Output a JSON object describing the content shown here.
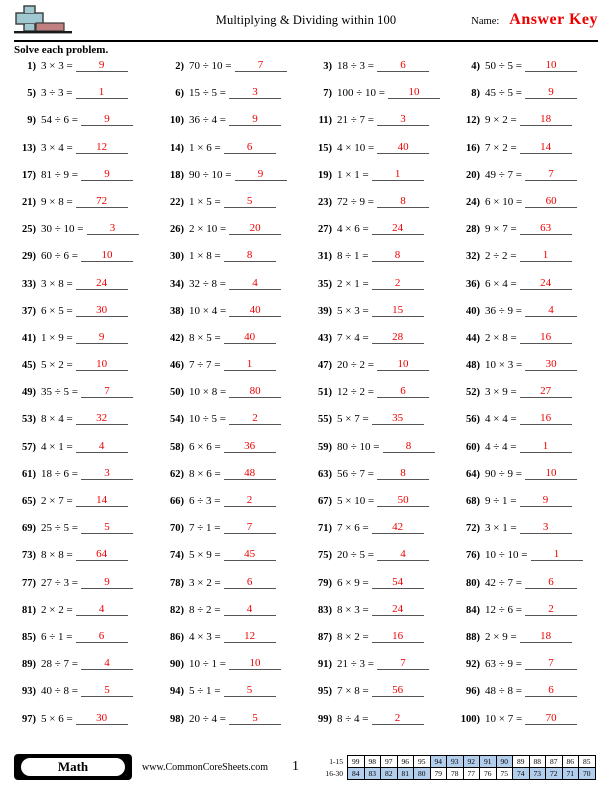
{
  "header": {
    "logo_icon": "plus-minus-icon",
    "title": "Multiplying & Dividing within 100",
    "name_label": "Name:",
    "name_value": "Answer Key"
  },
  "instructions": "Solve each problem.",
  "problems": [
    {
      "n": "1)",
      "expr": "3 × 3 =",
      "ans": "9"
    },
    {
      "n": "2)",
      "expr": "70 ÷ 10 =",
      "ans": "7"
    },
    {
      "n": "3)",
      "expr": "18 ÷ 3 =",
      "ans": "6"
    },
    {
      "n": "4)",
      "expr": "50 ÷ 5 =",
      "ans": "10"
    },
    {
      "n": "5)",
      "expr": "3 ÷ 3 =",
      "ans": "1"
    },
    {
      "n": "6)",
      "expr": "15 ÷ 5 =",
      "ans": "3"
    },
    {
      "n": "7)",
      "expr": "100 ÷ 10 =",
      "ans": "10"
    },
    {
      "n": "8)",
      "expr": "45 ÷ 5 =",
      "ans": "9"
    },
    {
      "n": "9)",
      "expr": "54 ÷ 6 =",
      "ans": "9"
    },
    {
      "n": "10)",
      "expr": "36 ÷ 4 =",
      "ans": "9"
    },
    {
      "n": "11)",
      "expr": "21 ÷ 7 =",
      "ans": "3"
    },
    {
      "n": "12)",
      "expr": "9 × 2 =",
      "ans": "18"
    },
    {
      "n": "13)",
      "expr": "3 × 4 =",
      "ans": "12"
    },
    {
      "n": "14)",
      "expr": "1 × 6 =",
      "ans": "6"
    },
    {
      "n": "15)",
      "expr": "4 × 10 =",
      "ans": "40"
    },
    {
      "n": "16)",
      "expr": "7 × 2 =",
      "ans": "14"
    },
    {
      "n": "17)",
      "expr": "81 ÷ 9 =",
      "ans": "9"
    },
    {
      "n": "18)",
      "expr": "90 ÷ 10 =",
      "ans": "9"
    },
    {
      "n": "19)",
      "expr": "1 × 1 =",
      "ans": "1"
    },
    {
      "n": "20)",
      "expr": "49 ÷ 7 =",
      "ans": "7"
    },
    {
      "n": "21)",
      "expr": "9 × 8 =",
      "ans": "72"
    },
    {
      "n": "22)",
      "expr": "1 × 5 =",
      "ans": "5"
    },
    {
      "n": "23)",
      "expr": "72 ÷ 9 =",
      "ans": "8"
    },
    {
      "n": "24)",
      "expr": "6 × 10 =",
      "ans": "60"
    },
    {
      "n": "25)",
      "expr": "30 ÷ 10 =",
      "ans": "3"
    },
    {
      "n": "26)",
      "expr": "2 × 10 =",
      "ans": "20"
    },
    {
      "n": "27)",
      "expr": "4 × 6 =",
      "ans": "24"
    },
    {
      "n": "28)",
      "expr": "9 × 7 =",
      "ans": "63"
    },
    {
      "n": "29)",
      "expr": "60 ÷ 6 =",
      "ans": "10"
    },
    {
      "n": "30)",
      "expr": "1 × 8 =",
      "ans": "8"
    },
    {
      "n": "31)",
      "expr": "8 ÷ 1 =",
      "ans": "8"
    },
    {
      "n": "32)",
      "expr": "2 ÷ 2 =",
      "ans": "1"
    },
    {
      "n": "33)",
      "expr": "3 × 8 =",
      "ans": "24"
    },
    {
      "n": "34)",
      "expr": "32 ÷ 8 =",
      "ans": "4"
    },
    {
      "n": "35)",
      "expr": "2 × 1 =",
      "ans": "2"
    },
    {
      "n": "36)",
      "expr": "6 × 4 =",
      "ans": "24"
    },
    {
      "n": "37)",
      "expr": "6 × 5 =",
      "ans": "30"
    },
    {
      "n": "38)",
      "expr": "10 × 4 =",
      "ans": "40"
    },
    {
      "n": "39)",
      "expr": "5 × 3 =",
      "ans": "15"
    },
    {
      "n": "40)",
      "expr": "36 ÷ 9 =",
      "ans": "4"
    },
    {
      "n": "41)",
      "expr": "1 × 9 =",
      "ans": "9"
    },
    {
      "n": "42)",
      "expr": "8 × 5 =",
      "ans": "40"
    },
    {
      "n": "43)",
      "expr": "7 × 4 =",
      "ans": "28"
    },
    {
      "n": "44)",
      "expr": "2 × 8 =",
      "ans": "16"
    },
    {
      "n": "45)",
      "expr": "5 × 2 =",
      "ans": "10"
    },
    {
      "n": "46)",
      "expr": "7 ÷ 7 =",
      "ans": "1"
    },
    {
      "n": "47)",
      "expr": "20 ÷ 2 =",
      "ans": "10"
    },
    {
      "n": "48)",
      "expr": "10 × 3 =",
      "ans": "30"
    },
    {
      "n": "49)",
      "expr": "35 ÷ 5 =",
      "ans": "7"
    },
    {
      "n": "50)",
      "expr": "10 × 8 =",
      "ans": "80"
    },
    {
      "n": "51)",
      "expr": "12 ÷ 2 =",
      "ans": "6"
    },
    {
      "n": "52)",
      "expr": "3 × 9 =",
      "ans": "27"
    },
    {
      "n": "53)",
      "expr": "8 × 4 =",
      "ans": "32"
    },
    {
      "n": "54)",
      "expr": "10 ÷ 5 =",
      "ans": "2"
    },
    {
      "n": "55)",
      "expr": "5 × 7 =",
      "ans": "35"
    },
    {
      "n": "56)",
      "expr": "4 × 4 =",
      "ans": "16"
    },
    {
      "n": "57)",
      "expr": "4 × 1 =",
      "ans": "4"
    },
    {
      "n": "58)",
      "expr": "6 × 6 =",
      "ans": "36"
    },
    {
      "n": "59)",
      "expr": "80 ÷ 10 =",
      "ans": "8"
    },
    {
      "n": "60)",
      "expr": "4 ÷ 4 =",
      "ans": "1"
    },
    {
      "n": "61)",
      "expr": "18 ÷ 6 =",
      "ans": "3"
    },
    {
      "n": "62)",
      "expr": "8 × 6 =",
      "ans": "48"
    },
    {
      "n": "63)",
      "expr": "56 ÷ 7 =",
      "ans": "8"
    },
    {
      "n": "64)",
      "expr": "90 ÷ 9 =",
      "ans": "10"
    },
    {
      "n": "65)",
      "expr": "2 × 7 =",
      "ans": "14"
    },
    {
      "n": "66)",
      "expr": "6 ÷ 3 =",
      "ans": "2"
    },
    {
      "n": "67)",
      "expr": "5 × 10 =",
      "ans": "50"
    },
    {
      "n": "68)",
      "expr": "9 ÷ 1 =",
      "ans": "9"
    },
    {
      "n": "69)",
      "expr": "25 ÷ 5 =",
      "ans": "5"
    },
    {
      "n": "70)",
      "expr": "7 ÷ 1 =",
      "ans": "7"
    },
    {
      "n": "71)",
      "expr": "7 × 6 =",
      "ans": "42"
    },
    {
      "n": "72)",
      "expr": "3 × 1 =",
      "ans": "3"
    },
    {
      "n": "73)",
      "expr": "8 × 8 =",
      "ans": "64"
    },
    {
      "n": "74)",
      "expr": "5 × 9 =",
      "ans": "45"
    },
    {
      "n": "75)",
      "expr": "20 ÷ 5 =",
      "ans": "4"
    },
    {
      "n": "76)",
      "expr": "10 ÷ 10 =",
      "ans": "1"
    },
    {
      "n": "77)",
      "expr": "27 ÷ 3 =",
      "ans": "9"
    },
    {
      "n": "78)",
      "expr": "3 × 2 =",
      "ans": "6"
    },
    {
      "n": "79)",
      "expr": "6 × 9 =",
      "ans": "54"
    },
    {
      "n": "80)",
      "expr": "42 ÷ 7 =",
      "ans": "6"
    },
    {
      "n": "81)",
      "expr": "2 × 2 =",
      "ans": "4"
    },
    {
      "n": "82)",
      "expr": "8 ÷ 2 =",
      "ans": "4"
    },
    {
      "n": "83)",
      "expr": "8 × 3 =",
      "ans": "24"
    },
    {
      "n": "84)",
      "expr": "12 ÷ 6 =",
      "ans": "2"
    },
    {
      "n": "85)",
      "expr": "6 ÷ 1 =",
      "ans": "6"
    },
    {
      "n": "86)",
      "expr": "4 × 3 =",
      "ans": "12"
    },
    {
      "n": "87)",
      "expr": "8 × 2 =",
      "ans": "16"
    },
    {
      "n": "88)",
      "expr": "2 × 9 =",
      "ans": "18"
    },
    {
      "n": "89)",
      "expr": "28 ÷ 7 =",
      "ans": "4"
    },
    {
      "n": "90)",
      "expr": "10 ÷ 1 =",
      "ans": "10"
    },
    {
      "n": "91)",
      "expr": "21 ÷ 3 =",
      "ans": "7"
    },
    {
      "n": "92)",
      "expr": "63 ÷ 9 =",
      "ans": "7"
    },
    {
      "n": "93)",
      "expr": "40 ÷ 8 =",
      "ans": "5"
    },
    {
      "n": "94)",
      "expr": "5 ÷ 1 =",
      "ans": "5"
    },
    {
      "n": "95)",
      "expr": "7 × 8 =",
      "ans": "56"
    },
    {
      "n": "96)",
      "expr": "48 ÷ 8 =",
      "ans": "6"
    },
    {
      "n": "97)",
      "expr": "5 × 6 =",
      "ans": "30"
    },
    {
      "n": "98)",
      "expr": "20 ÷ 4 =",
      "ans": "5"
    },
    {
      "n": "99)",
      "expr": "8 ÷ 4 =",
      "ans": "2"
    },
    {
      "n": "100)",
      "expr": "10 × 7 =",
      "ans": "70"
    }
  ],
  "footer": {
    "subject": "Math",
    "site_url": "www.CommonCoreSheets.com",
    "page_number": "1",
    "score_table": {
      "highlight_color": "#b3cdec",
      "rows": [
        {
          "label": "1-15",
          "cells": [
            {
              "v": "99",
              "hl": false
            },
            {
              "v": "98",
              "hl": false
            },
            {
              "v": "97",
              "hl": false
            },
            {
              "v": "96",
              "hl": false
            },
            {
              "v": "95",
              "hl": false
            },
            {
              "v": "94",
              "hl": true
            },
            {
              "v": "93",
              "hl": true
            },
            {
              "v": "92",
              "hl": true
            },
            {
              "v": "91",
              "hl": true
            },
            {
              "v": "90",
              "hl": true
            },
            {
              "v": "89",
              "hl": false
            },
            {
              "v": "88",
              "hl": false
            },
            {
              "v": "87",
              "hl": false
            },
            {
              "v": "86",
              "hl": false
            },
            {
              "v": "85",
              "hl": false
            }
          ]
        },
        {
          "label": "16-30",
          "cells": [
            {
              "v": "84",
              "hl": true
            },
            {
              "v": "83",
              "hl": true
            },
            {
              "v": "82",
              "hl": true
            },
            {
              "v": "81",
              "hl": true
            },
            {
              "v": "80",
              "hl": true
            },
            {
              "v": "79",
              "hl": false
            },
            {
              "v": "78",
              "hl": false
            },
            {
              "v": "77",
              "hl": false
            },
            {
              "v": "76",
              "hl": false
            },
            {
              "v": "75",
              "hl": false
            },
            {
              "v": "74",
              "hl": true
            },
            {
              "v": "73",
              "hl": true
            },
            {
              "v": "72",
              "hl": true
            },
            {
              "v": "71",
              "hl": true
            },
            {
              "v": "70",
              "hl": true
            }
          ]
        }
      ]
    }
  }
}
